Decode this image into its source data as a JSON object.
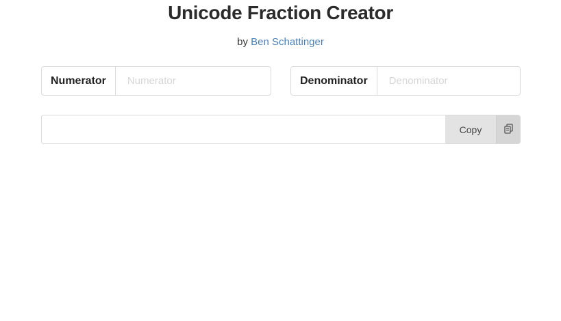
{
  "header": {
    "title": "Unicode Fraction Creator",
    "by_prefix": "by",
    "author_name": "Ben Schattinger"
  },
  "numerator": {
    "label": "Numerator",
    "placeholder": "Numerator",
    "value": ""
  },
  "denominator": {
    "label": "Denominator",
    "placeholder": "Denominator",
    "value": ""
  },
  "output": {
    "value": "",
    "copy_label": "Copy",
    "copy_icon": "clipboard-icon"
  },
  "colors": {
    "link": "#4a7fb5",
    "border": "#d9d9d9",
    "button_bg": "#e3e3e3",
    "icon_button_bg": "#d6d6d6",
    "placeholder": "#d6d6d6"
  }
}
